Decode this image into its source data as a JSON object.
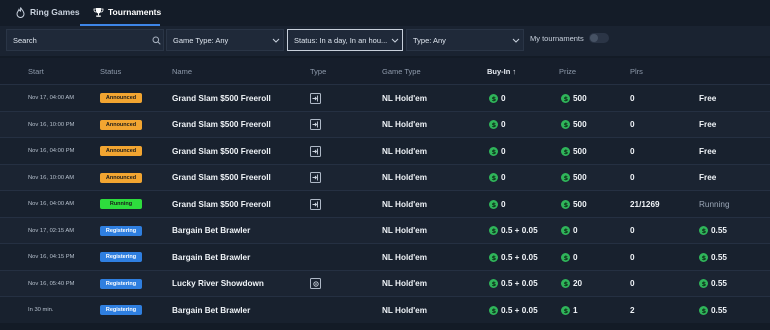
{
  "tabs": [
    {
      "label": "Ring Games",
      "icon": "flame-icon",
      "active": false
    },
    {
      "label": "Tournaments",
      "icon": "trophy-icon",
      "active": true
    }
  ],
  "filters": {
    "search_placeholder": "Search",
    "game_type": "Game Type: Any",
    "status": "Status: In a day, In an hou...",
    "type": "Type: Any",
    "my_tournaments_label": "My tournaments",
    "my_tournaments_on": false
  },
  "table": {
    "headers": [
      "Start",
      "Status",
      "Name",
      "Type",
      "Game Type",
      "Buy-In ↑",
      "Prize",
      "Plrs",
      ""
    ],
    "rows": [
      {
        "start": "Nov 17, 04:00 AM",
        "status": "Announced",
        "name": "Grand Slam $500 Freeroll",
        "type_icon": "enter-icon",
        "game_type": "NL Hold'em",
        "buyin": "0",
        "prize_coin": true,
        "prize": "500",
        "plrs": "0",
        "last": "Free",
        "last_coin": false
      },
      {
        "start": "Nov 16, 10:00 PM",
        "status": "Announced",
        "name": "Grand Slam $500 Freeroll",
        "type_icon": "enter-icon",
        "game_type": "NL Hold'em",
        "buyin": "0",
        "prize_coin": true,
        "prize": "500",
        "plrs": "0",
        "last": "Free",
        "last_coin": false
      },
      {
        "start": "Nov 16, 04:00 PM",
        "status": "Announced",
        "name": "Grand Slam $500 Freeroll",
        "type_icon": "enter-icon",
        "game_type": "NL Hold'em",
        "buyin": "0",
        "prize_coin": true,
        "prize": "500",
        "plrs": "0",
        "last": "Free",
        "last_coin": false
      },
      {
        "start": "Nov 16, 10:00 AM",
        "status": "Announced",
        "name": "Grand Slam $500 Freeroll",
        "type_icon": "enter-icon",
        "game_type": "NL Hold'em",
        "buyin": "0",
        "prize_coin": true,
        "prize": "500",
        "plrs": "0",
        "last": "Free",
        "last_coin": false
      },
      {
        "start": "Nov 16, 04:00 AM",
        "status": "Running",
        "name": "Grand Slam $500 Freeroll",
        "type_icon": "enter-icon",
        "game_type": "NL Hold'em",
        "buyin": "0",
        "prize_coin": true,
        "prize": "500",
        "plrs": "21/1269",
        "last": "Running",
        "last_coin": false
      },
      {
        "start": "Nov 17, 02:15 AM",
        "status": "Registering",
        "name": "Bargain Bet Brawler",
        "type_icon": "",
        "game_type": "NL Hold'em",
        "buyin": "0.5 + 0.05",
        "prize_coin": true,
        "prize": "0",
        "plrs": "0",
        "last": "0.55",
        "last_coin": true
      },
      {
        "start": "Nov 16, 04:15 PM",
        "status": "Registering",
        "name": "Bargain Bet Brawler",
        "type_icon": "",
        "game_type": "NL Hold'em",
        "buyin": "0.5 + 0.05",
        "prize_coin": true,
        "prize": "0",
        "plrs": "0",
        "last": "0.55",
        "last_coin": true
      },
      {
        "start": "Nov 16, 05:40 PM",
        "status": "Registering",
        "name": "Lucky River Showdown",
        "type_icon": "gear-icon",
        "game_type": "NL Hold'em",
        "buyin": "0.5 + 0.05",
        "prize_coin": true,
        "prize": "20",
        "plrs": "0",
        "last": "0.55",
        "last_coin": true
      },
      {
        "start": "In 30 min.",
        "status": "Registering",
        "name": "Bargain Bet Brawler",
        "type_icon": "",
        "game_type": "NL Hold'em",
        "buyin": "0.5 + 0.05",
        "prize_coin": true,
        "prize": "1",
        "plrs": "2",
        "last": "0.55",
        "last_coin": true
      }
    ]
  },
  "colors": {
    "accent": "#3e86e8",
    "announced": "#f2a531",
    "running": "#2edc3d",
    "registering": "#2f7fe0",
    "coin": "#2fb55a"
  }
}
